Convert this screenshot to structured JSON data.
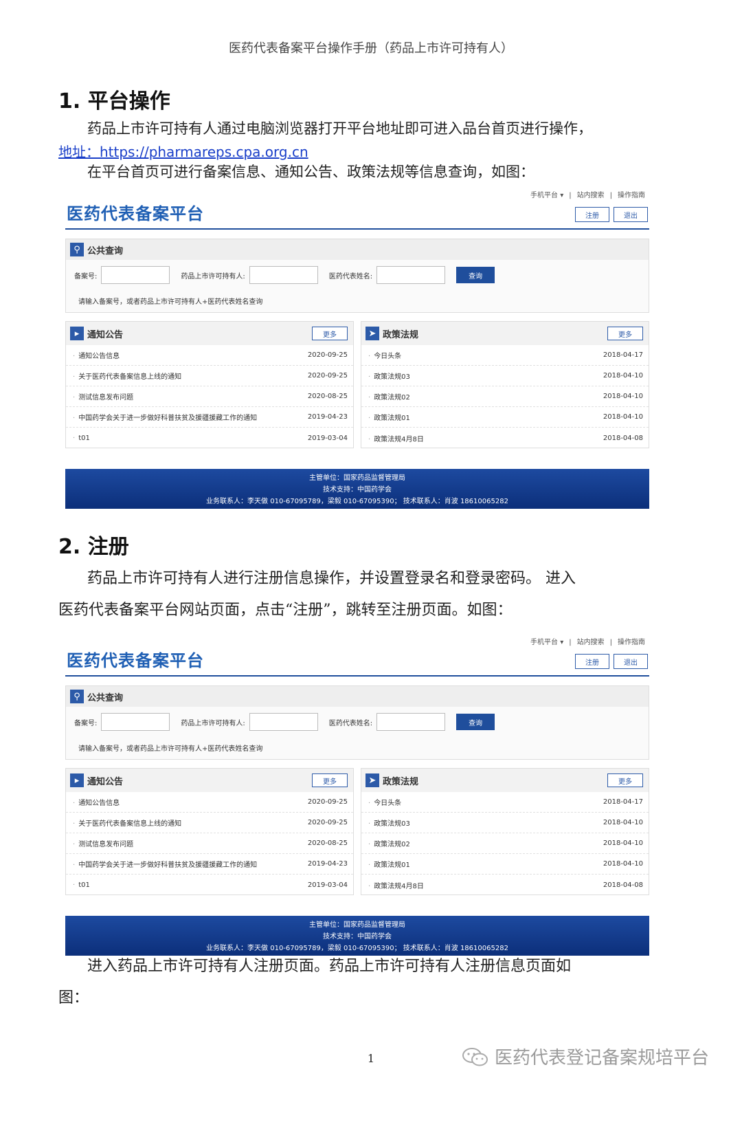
{
  "header": "医药代表备案平台操作手册（药品上市许可持有人）",
  "section1": {
    "title": "1. 平台操作",
    "para1": "药品上市许可持有人通过电脑浏览器打开平台地址即可进入品台首页进行操作，",
    "link": "地址：https://pharmareps.cpa.org.cn",
    "para2": "在平台首页可进行备案信息、通知公告、政策法规等信息查询，如图："
  },
  "section2": {
    "title": "2. 注册",
    "para1_line1": "药品上市许可持有人进行注册信息操作，并设置登录名和登录密码。 进入",
    "para1_line2": "医药代表备案平台网站页面，点击“注册”，跳转至注册页面。如图：",
    "para2_line1": "进入药品上市许可持有人注册页面。药品上市许可持有人注册信息页面如",
    "para2_line2": "图："
  },
  "portal": {
    "top_links": [
      "手机平台 ▾",
      "|",
      "站内搜索",
      "|",
      "操作指南"
    ],
    "logo": "医药代表备案平台",
    "register": "注册",
    "logout": "退出",
    "query_title": "公共查询",
    "label_record": "备案号:",
    "label_holder": "药品上市许可持有人:",
    "label_rep": "医药代表姓名:",
    "query_btn": "查询",
    "query_hint": "请输入备案号，或者药品上市许可持有人+医药代表姓名查询",
    "notice_title": "通知公告",
    "policy_title": "政策法规",
    "more": "更多",
    "notices": [
      {
        "title": "通知公告信息",
        "date": "2020-09-25"
      },
      {
        "title": "关于医药代表备案信息上线的通知",
        "date": "2020-09-25"
      },
      {
        "title": "测试信息发布问题",
        "date": "2020-08-25"
      },
      {
        "title": "中国药学会关于进一步做好科普扶贫及援疆援藏工作的通知",
        "date": "2019-04-23"
      },
      {
        "title": "t01",
        "date": "2019-03-04"
      }
    ],
    "policies": [
      {
        "title": "今日头条",
        "date": "2018-04-17"
      },
      {
        "title": "政策法规03",
        "date": "2018-04-10"
      },
      {
        "title": "政策法规02",
        "date": "2018-04-10"
      },
      {
        "title": "政策法规01",
        "date": "2018-04-10"
      },
      {
        "title": "政策法规4月8日",
        "date": "2018-04-08"
      }
    ],
    "footer_line1": "主管单位：国家药品监督管理局",
    "footer_line2": "技术支持：中国药学会",
    "footer_line3": "业务联系人：李天做 010-67095789，梁毅 010-67095390；  技术联系人：肖波 18610065282"
  },
  "page_number": "1",
  "watermark": "医药代表登记备案规培平台"
}
